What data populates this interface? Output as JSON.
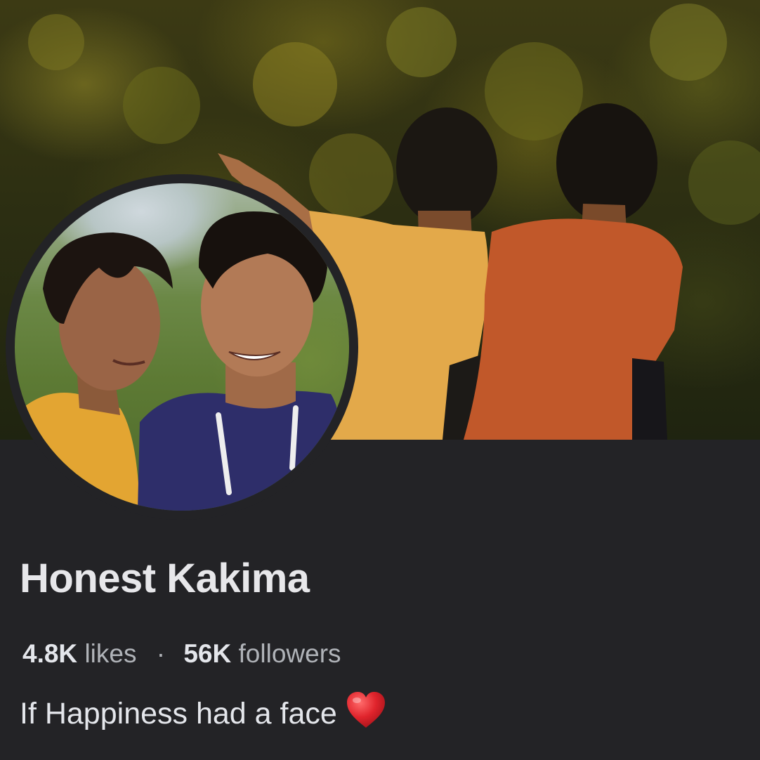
{
  "page": {
    "name": "Honest Kakima",
    "likes_count": "4.8K",
    "likes_label": "likes",
    "separator": "·",
    "followers_count": "56K",
    "followers_label": "followers",
    "bio_text": "If Happiness had a face",
    "bio_emoji_icon": "red-heart-icon"
  },
  "colors": {
    "background": "#232326",
    "name_text": "#e7e7ea",
    "secondary_text": "#b0b3b8",
    "heart": "#e0242c"
  }
}
